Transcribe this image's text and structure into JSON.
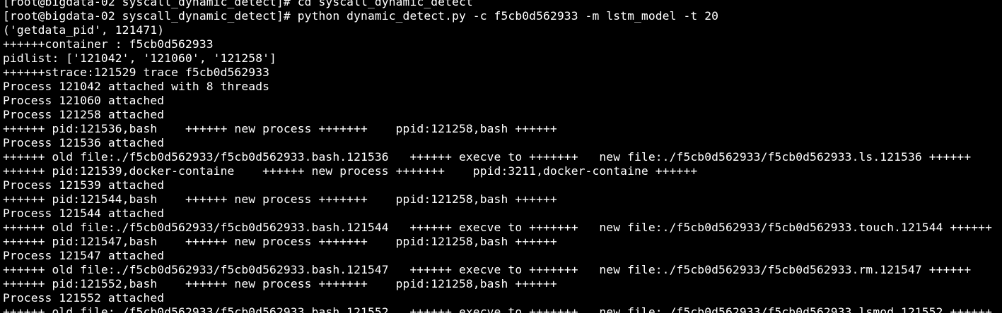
{
  "terminal": {
    "background": "#000000",
    "foreground": "#ffffff",
    "lines": [
      "[root@bigdata-02 syscall_dynamic_detect]# cd syscall_dynamic_detect",
      "[root@bigdata-02 syscall_dynamic_detect]# python dynamic_detect.py -c f5cb0d562933 -m lstm_model -t 20",
      "('getdata_pid', 121471)",
      "++++++container : f5cb0d562933",
      "pidlist: ['121042', '121060', '121258']",
      "++++++strace:121529 trace f5cb0d562933",
      "Process 121042 attached with 8 threads",
      "Process 121060 attached",
      "Process 121258 attached",
      "++++++ pid:121536,bash    ++++++ new process +++++++    ppid:121258,bash ++++++",
      "Process 121536 attached",
      "++++++ old file:./f5cb0d562933/f5cb0d562933.bash.121536   ++++++ execve to +++++++   new file:./f5cb0d562933/f5cb0d562933.ls.121536 ++++++",
      "++++++ pid:121539,docker-containe    ++++++ new process +++++++    ppid:3211,docker-containe ++++++",
      "Process 121539 attached",
      "++++++ pid:121544,bash    ++++++ new process +++++++    ppid:121258,bash ++++++",
      "Process 121544 attached",
      "++++++ old file:./f5cb0d562933/f5cb0d562933.bash.121544   ++++++ execve to +++++++   new file:./f5cb0d562933/f5cb0d562933.touch.121544 ++++++",
      "++++++ pid:121547,bash    ++++++ new process +++++++    ppid:121258,bash ++++++",
      "Process 121547 attached",
      "++++++ old file:./f5cb0d562933/f5cb0d562933.bash.121547   ++++++ execve to +++++++   new file:./f5cb0d562933/f5cb0d562933.rm.121547 ++++++",
      "++++++ pid:121552,bash    ++++++ new process +++++++    ppid:121258,bash ++++++",
      "Process 121552 attached",
      "++++++ old file:./f5cb0d562933/f5cb0d562933.bash.121552   ++++++ execve to +++++++   new file:./f5cb0d562933/f5cb0d562933.lsmod.121552 ++++++"
    ]
  }
}
